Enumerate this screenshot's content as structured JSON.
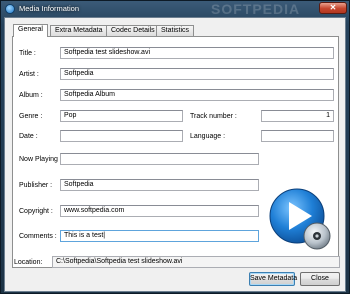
{
  "window": {
    "title": "Media Information",
    "watermark": "SOFTPEDIA",
    "close_glyph": "✕"
  },
  "tabs": [
    {
      "label": "General",
      "active": true
    },
    {
      "label": "Extra Metadata",
      "active": false
    },
    {
      "label": "Codec Details",
      "active": false
    },
    {
      "label": "Statistics",
      "active": false
    }
  ],
  "form": {
    "title_label": "Title :",
    "title_value": "Softpedia test slideshow.avi",
    "artist_label": "Artist :",
    "artist_value": "Softpedia",
    "album_label": "Album :",
    "album_value": "Softpedia Album",
    "genre_label": "Genre :",
    "genre_value": "Pop",
    "track_label": "Track number :",
    "track_value": "1",
    "date_label": "Date :",
    "date_value": "",
    "language_label": "Language :",
    "language_value": "",
    "nowplaying_label": "Now Playing :",
    "nowplaying_value": "",
    "publisher_label": "Publisher :",
    "publisher_value": "Softpedia",
    "copyright_label": "Copyright :",
    "copyright_value": "www.softpedia.com",
    "comments_label": "Comments :",
    "comments_value": "This is a test|"
  },
  "location": {
    "label": "Location:",
    "value": "C:\\Softpedia\\Softpedia test slideshow.avi"
  },
  "buttons": {
    "save_label": "Save Metadata",
    "close_label": "Close"
  },
  "icons": {
    "app": "media-player-icon",
    "logo": "play-disc-logo-icon"
  }
}
